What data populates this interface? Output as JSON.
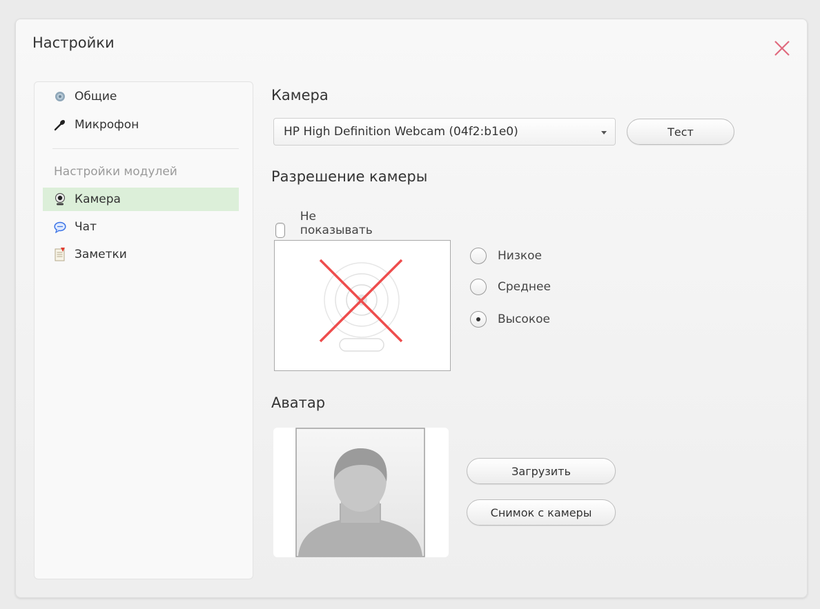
{
  "dialog": {
    "title": "Настройки"
  },
  "sidebar": {
    "items": [
      {
        "label": "Общие",
        "icon": "gear-icon"
      },
      {
        "label": "Микрофон",
        "icon": "microphone-icon"
      }
    ],
    "group_label": "Настройки модулей",
    "module_items": [
      {
        "label": "Камера",
        "icon": "webcam-icon",
        "active": true
      },
      {
        "label": "Чат",
        "icon": "chat-bubble-icon"
      },
      {
        "label": "Заметки",
        "icon": "notes-icon"
      }
    ]
  },
  "camera": {
    "title": "Камера",
    "selected_device": "HP High Definition Webcam (04f2:b1e0)",
    "test_label": "Тест"
  },
  "resolution": {
    "title": "Разрешение камеры",
    "hide_video_label": "Не показывать видео",
    "hide_video_checked": false,
    "options": [
      "Низкое",
      "Среднее",
      "Высокое"
    ],
    "selected": "Высокое"
  },
  "avatar": {
    "title": "Аватар",
    "upload_label": "Загрузить",
    "snapshot_label": "Снимок с камеры"
  },
  "colors": {
    "active_item_bg": "#dcefd9",
    "close_x": "#e06a7e",
    "no_video_cross": "#ee4d4d"
  }
}
